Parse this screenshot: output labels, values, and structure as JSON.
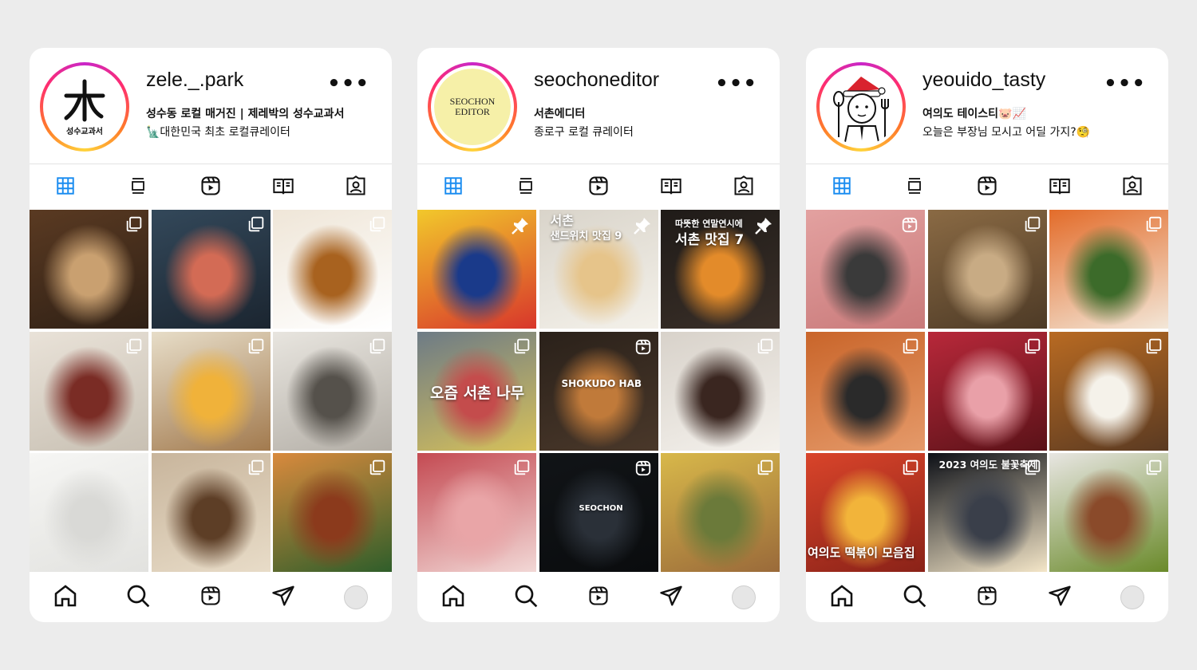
{
  "profiles": [
    {
      "username": "zele._.park",
      "bio_line1": "성수동 로컬 매거진 | 제레박의 성수교과서",
      "bio_line2": "🗽대한민국 최초 로컬큐레이터",
      "avatar_text": "성수교과서",
      "tiles": [
        {
          "desc": "grilled-skewers-beer",
          "colors": [
            "#5a3a22",
            "#c9a070",
            "#2f2015"
          ],
          "badge": "multi",
          "caption": ""
        },
        {
          "desc": "night-market-street",
          "colors": [
            "#33485a",
            "#d36b55",
            "#1b2530"
          ],
          "badge": "multi",
          "caption": ""
        },
        {
          "desc": "custard-pudding-plate",
          "colors": [
            "#efe6d8",
            "#a8621f",
            "#ffffff"
          ],
          "badge": "multi",
          "caption": ""
        },
        {
          "desc": "nyam-storefront",
          "colors": [
            "#e9e2d8",
            "#7a2c25",
            "#c8c0b3"
          ],
          "badge": "multi",
          "caption": ""
        },
        {
          "desc": "egg-sandwich-hand",
          "colors": [
            "#e7ddc8",
            "#f0b23a",
            "#a27a4e"
          ],
          "badge": "multi",
          "caption": ""
        },
        {
          "desc": "superfine-storefront",
          "colors": [
            "#e8e5df",
            "#55514b",
            "#b3aea6"
          ],
          "badge": "multi",
          "caption": ""
        },
        {
          "desc": "samcho-egg-map",
          "colors": [
            "#f6f6f4",
            "#d9d9d6",
            "#e2e2df"
          ],
          "badge": "",
          "caption": ""
        },
        {
          "desc": "pudding-cups-tray",
          "colors": [
            "#c8b59c",
            "#5d3e26",
            "#e8dcc8"
          ],
          "badge": "multi",
          "caption": ""
        },
        {
          "desc": "bacon-burger",
          "colors": [
            "#d98a3d",
            "#8b3a1c",
            "#2f5e2a"
          ],
          "badge": "multi",
          "caption": ""
        }
      ]
    },
    {
      "username": "seochoneditor",
      "bio_line1": "서촌에디터",
      "bio_line2": "종로구 로컬 큐레이터",
      "avatar_text": "SEOCHON EDITOR",
      "tiles": [
        {
          "desc": "yellow-poster-board",
          "colors": [
            "#f2c82b",
            "#1a3a8a",
            "#d8362b"
          ],
          "badge": "pin",
          "caption": ""
        },
        {
          "desc": "sandwich-closeup",
          "colors": [
            "#d9d4ca",
            "#e6c48a",
            "#f4f1ea"
          ],
          "badge": "pin",
          "caption": "서촌\n샌드위치 맛집 9"
        },
        {
          "desc": "campfire-night",
          "colors": [
            "#1f1b18",
            "#e38b2a",
            "#3a2f28"
          ],
          "badge": "pin",
          "caption": "따뜻한 연말연시에\n서촌 맛집 7"
        },
        {
          "desc": "knitted-tree-wraps",
          "colors": [
            "#6d7b86",
            "#c44c4c",
            "#d7c15a"
          ],
          "badge": "multi",
          "caption": "오즘 서촌 나무"
        },
        {
          "desc": "shokudo-hab-kitchen",
          "colors": [
            "#2a211a",
            "#c07a3a",
            "#4a382a"
          ],
          "badge": "reel",
          "caption": "SHOKUDO HAB"
        },
        {
          "desc": "chocolate-lava-cake",
          "colors": [
            "#d8d2ca",
            "#3a2620",
            "#f4f1ec"
          ],
          "badge": "multi",
          "caption": ""
        },
        {
          "desc": "sashimi-plate",
          "colors": [
            "#c44a52",
            "#e9a5a7",
            "#f2d8d6"
          ],
          "badge": "multi",
          "caption": ""
        },
        {
          "desc": "seochon-bar-night",
          "colors": [
            "#111417",
            "#2a3038",
            "#0a0c0e"
          ],
          "badge": "reel",
          "caption": "SEOCHON"
        },
        {
          "desc": "ginkgo-tree-building",
          "colors": [
            "#d8b84a",
            "#6b7a3a",
            "#9a6a3a"
          ],
          "badge": "multi",
          "caption": ""
        }
      ]
    },
    {
      "username": "yeouido_tasty",
      "bio_line1": "여의도 테이스티🐷📈",
      "bio_line2": "오늘은 부장님 모시고 어딜 가지?🧐",
      "avatar_text": "",
      "tiles": [
        {
          "desc": "pork-belly-abalone",
          "colors": [
            "#e3a1a0",
            "#3a3a3a",
            "#c97a7a"
          ],
          "badge": "reel",
          "caption": ""
        },
        {
          "desc": "teddy-bear-cafe",
          "colors": [
            "#8a6a44",
            "#c8ab84",
            "#4d3a26"
          ],
          "badge": "multi",
          "caption": ""
        },
        {
          "desc": "spicy-chicken-bowl",
          "colors": [
            "#e36c2a",
            "#3c6b2a",
            "#f3e7d8"
          ],
          "badge": "multi",
          "caption": ""
        },
        {
          "desc": "grilled-shrimp",
          "colors": [
            "#c9652a",
            "#2a2a2a",
            "#e59a6a"
          ],
          "badge": "multi",
          "caption": ""
        },
        {
          "desc": "marbled-beef",
          "colors": [
            "#b8283a",
            "#e9a0a8",
            "#5a1218"
          ],
          "badge": "multi",
          "caption": ""
        },
        {
          "desc": "tonkatsu-curry-plate",
          "colors": [
            "#b86a22",
            "#f5f2ea",
            "#5a3a22"
          ],
          "badge": "multi",
          "caption": ""
        },
        {
          "desc": "tteokbokki-collection",
          "colors": [
            "#d9442a",
            "#f2b43a",
            "#8a2218"
          ],
          "badge": "multi",
          "caption": "여의도 떡볶이 모음집"
        },
        {
          "desc": "fireworks-night",
          "colors": [
            "#0c0f16",
            "#3a3f4a",
            "#f4e6c8"
          ],
          "badge": "multi",
          "caption": "2023 여의도 불꽃축제"
        },
        {
          "desc": "layered-sandwich",
          "colors": [
            "#e8e6e2",
            "#8a4a2a",
            "#6a8a2a"
          ],
          "badge": "multi",
          "caption": ""
        }
      ]
    }
  ],
  "tab_icons": [
    "grid-icon",
    "feed-icon",
    "reels-icon",
    "guide-icon",
    "tagged-icon"
  ],
  "nav_icons": [
    "home-icon",
    "search-icon",
    "reels-icon",
    "direct-icon",
    "profile-icon"
  ],
  "colors": {
    "active_tab": "#1a8cf0",
    "icon": "#111111",
    "background": "#ececec"
  }
}
